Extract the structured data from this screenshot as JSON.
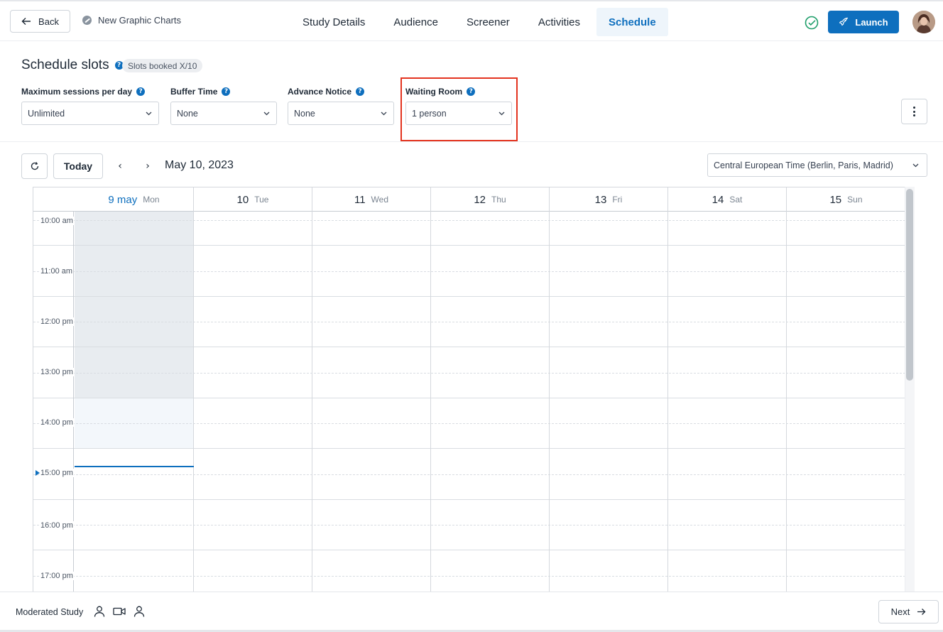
{
  "header": {
    "back_label": "Back",
    "study_name": "New Graphic Charts",
    "tabs": [
      {
        "label": "Study Details",
        "active": false
      },
      {
        "label": "Audience",
        "active": false
      },
      {
        "label": "Screener",
        "active": false
      },
      {
        "label": "Activities",
        "active": false
      },
      {
        "label": "Schedule",
        "active": true
      }
    ],
    "launch_label": "Launch",
    "icons": {
      "back": "arrow-left-icon",
      "status": "edit-status-icon",
      "check": "check-circle-icon",
      "launch": "rocket-icon"
    }
  },
  "settings": {
    "title": "Schedule slots",
    "slots_badge": "Slots booked X/10",
    "fields": [
      {
        "label": "Maximum sessions per day",
        "value": "Unlimited"
      },
      {
        "label": "Buffer Time",
        "value": "None"
      },
      {
        "label": "Advance Notice",
        "value": "None"
      },
      {
        "label": "Waiting Room",
        "value": "1 person"
      }
    ],
    "help_glyph": "?"
  },
  "calendar": {
    "today_label": "Today",
    "prev_glyph": "‹",
    "next_glyph": "›",
    "current_date": "May 10, 2023",
    "timezone": "Central European Time (Berlin, Paris, Madrid)",
    "days": [
      {
        "num": "9 may",
        "name": "Mon",
        "today": true
      },
      {
        "num": "10",
        "name": "Tue"
      },
      {
        "num": "11",
        "name": "Wed"
      },
      {
        "num": "12",
        "name": "Thu"
      },
      {
        "num": "13",
        "name": "Fri"
      },
      {
        "num": "14",
        "name": "Sat"
      },
      {
        "num": "15",
        "name": "Sun"
      }
    ],
    "times": [
      "10:00 am",
      "11:00 am",
      "12:00 pm",
      "13:00 pm",
      "14:00 pm",
      "15:00 pm",
      "16:00 pm",
      "17:00 pm"
    ]
  },
  "footer": {
    "label": "Moderated Study",
    "next_label": "Next",
    "icons": [
      "person-icon",
      "video-icon",
      "person-icon"
    ]
  },
  "colors": {
    "accent": "#0e6fbe",
    "highlight": "#e3331f",
    "success": "#1e9e6a"
  }
}
